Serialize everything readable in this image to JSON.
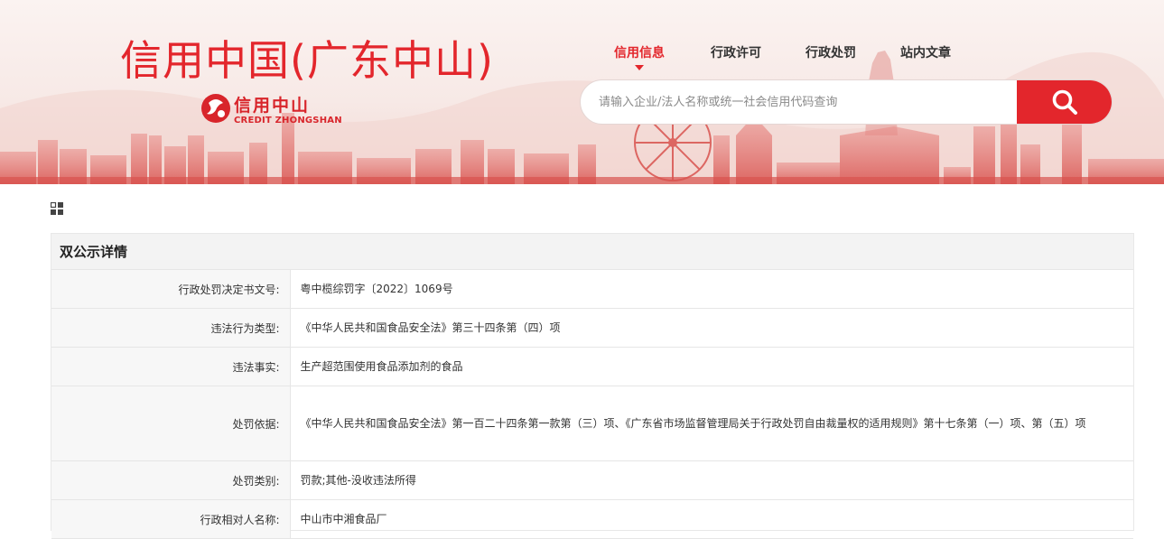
{
  "header": {
    "site_title": "信用中国(广东中山)",
    "logo": {
      "cn": "信用中山",
      "en": "CREDIT ZHONGSHAN"
    },
    "nav": [
      {
        "label": "信用信息",
        "active": true
      },
      {
        "label": "行政许可",
        "active": false
      },
      {
        "label": "行政处罚",
        "active": false
      },
      {
        "label": "站内文章",
        "active": false
      }
    ],
    "search": {
      "placeholder": "请输入企业/法人名称或统一社会信用代码查询",
      "value": "",
      "icon": "search-icon"
    }
  },
  "colors": {
    "brand_red": "#e3262c",
    "label_bg": "#f7f7f7",
    "header_bg": "#f3f3f3"
  },
  "detail": {
    "title": "双公示详情",
    "rows": [
      {
        "label": "行政处罚决定书文号:",
        "value": "粤中榄综罚字〔2022〕1069号"
      },
      {
        "label": "违法行为类型:",
        "value": "《中华人民共和国食品安全法》第三十四条第（四）项"
      },
      {
        "label": "违法事实:",
        "value": "生产超范围使用食品添加剂的食品"
      },
      {
        "label": "处罚依据:",
        "value": "《中华人民共和国食品安全法》第一百二十四条第一款第（三）项、《广东省市场监督管理局关于行政处罚自由裁量权的适用规则》第十七条第（一）项、第（五）项"
      },
      {
        "label": "处罚类别:",
        "value": "罚款;其他-没收违法所得"
      },
      {
        "label": "行政相对人名称:",
        "value": "中山市中湘食品厂"
      }
    ]
  }
}
